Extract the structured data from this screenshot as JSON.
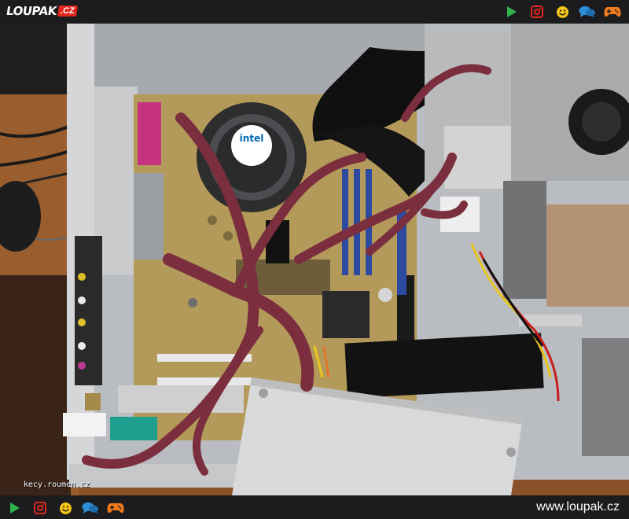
{
  "header": {
    "logo": {
      "name": "LOUPAK",
      "tld": ".CZ"
    },
    "icons": [
      "play-icon",
      "instagram-icon",
      "smiley-icon",
      "chat-icon",
      "gamepad-icon"
    ]
  },
  "photo": {
    "watermark": "kecy.roumen.cz",
    "chip_label": "intel"
  },
  "footer": {
    "icons": [
      "play-icon",
      "instagram-icon",
      "smiley-icon",
      "chat-icon",
      "gamepad-icon"
    ],
    "site_url": "www.loupak.cz"
  },
  "colors": {
    "bar_bg": "#1c1c1f",
    "play": "#2fb34a",
    "instagram": "#e2261d",
    "smiley": "#f5c518",
    "chat": "#2d8fd8",
    "gamepad": "#f07b1d",
    "cable_sleeve": "#7b2e3d"
  }
}
